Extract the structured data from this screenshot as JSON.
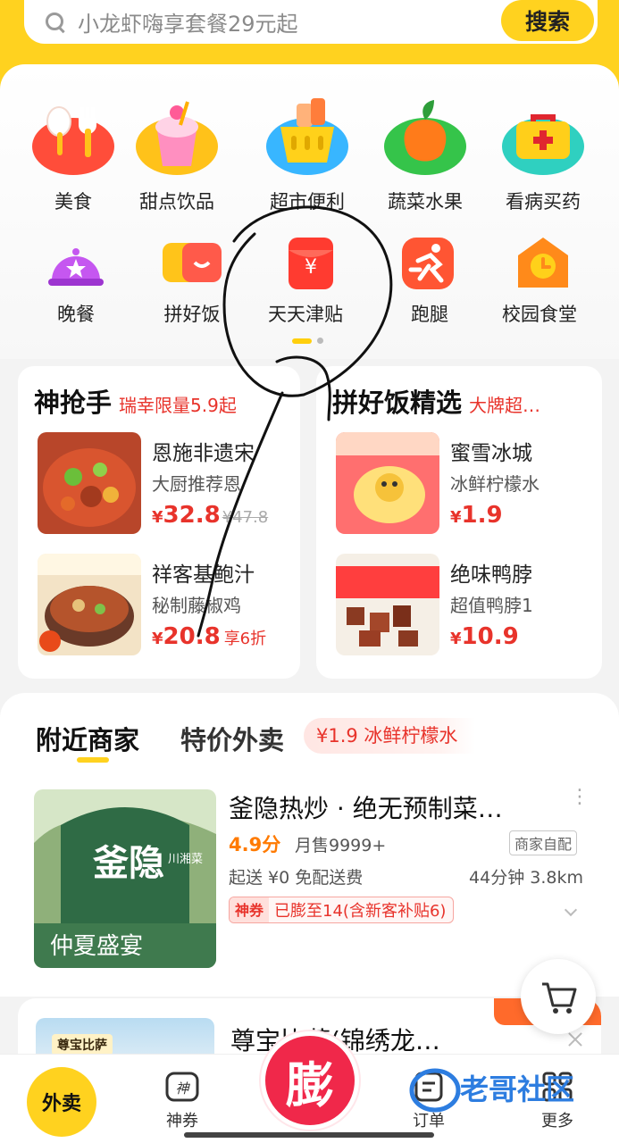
{
  "search": {
    "placeholder": "小龙虾嗨享套餐29元起",
    "button_label": "搜索"
  },
  "categories_row1": [
    {
      "label": "美食",
      "icon": "tableware-icon"
    },
    {
      "label": "甜点饮品",
      "icon": "dessert-cup-icon"
    },
    {
      "label": "超市便利",
      "icon": "shopping-basket-icon"
    },
    {
      "label": "蔬菜水果",
      "icon": "fruit-icon"
    },
    {
      "label": "看病买药",
      "icon": "medicine-box-icon"
    }
  ],
  "categories_row2": [
    {
      "label": "晚餐",
      "icon": "dinner-cloche-icon"
    },
    {
      "label": "拼好饭",
      "icon": "group-meal-icon"
    },
    {
      "label": "天天津贴",
      "icon": "red-envelope-icon"
    },
    {
      "label": "跑腿",
      "icon": "runner-icon"
    },
    {
      "label": "校园食堂",
      "icon": "campus-canteen-icon"
    }
  ],
  "deals_left": {
    "title": "神抢手",
    "subtitle": "瑞幸限量5.9起",
    "items": [
      {
        "name": "恩施非遗宋",
        "desc": "大厨推荐恩",
        "currency": "¥",
        "price": "32.8",
        "old_price": "¥47.8",
        "tag": ""
      },
      {
        "name": "祥客基鲍汁",
        "desc": "秘制藤椒鸡",
        "currency": "¥",
        "price": "20.8",
        "old_price": "",
        "tag": "享6折"
      }
    ]
  },
  "deals_right": {
    "title": "拼好饭精选",
    "subtitle": "大牌超…",
    "items": [
      {
        "name": "蜜雪冰城",
        "desc": "冰鲜柠檬水",
        "currency": "¥",
        "price": "1.9",
        "old_price": "",
        "tag": ""
      },
      {
        "name": "绝味鸭脖",
        "desc": "超值鸭脖1",
        "currency": "¥",
        "price": "10.9",
        "old_price": "",
        "tag": ""
      }
    ]
  },
  "nearby": {
    "tab_active": "附近商家",
    "tab_other": "特价外卖",
    "promo": "¥1.9 冰鲜柠檬水"
  },
  "shop1": {
    "name": "釜隐热炒 · 绝无预制菜…",
    "rating": "4.9分",
    "sales": "月售9999+",
    "delivery_badge": "商家自配",
    "fee": "起送 ¥0  免配送费",
    "time_distance": "44分钟  3.8km",
    "coupon_tag": "神券",
    "coupon_text": "已膨至14(含新客补贴6)",
    "image_text_main": "釜隐",
    "image_text_sub": "川湘菜",
    "image_text_bottom": "仲夏盛宴"
  },
  "shop2": {
    "name": "尊宝比萨(锦绣龙…",
    "image_label": "尊宝比萨"
  },
  "bottom_nav": {
    "waimai": "外卖",
    "coupon": "神券",
    "coupon_icon_text": "神",
    "peng": "膨",
    "orders": "订单",
    "more": "更多"
  },
  "watermark_text": "老哥社区",
  "colors": {
    "brand_yellow": "#ffd21f",
    "price_red": "#e8332b",
    "rating_orange": "#ff7a00",
    "peng_red": "#f0284a"
  }
}
